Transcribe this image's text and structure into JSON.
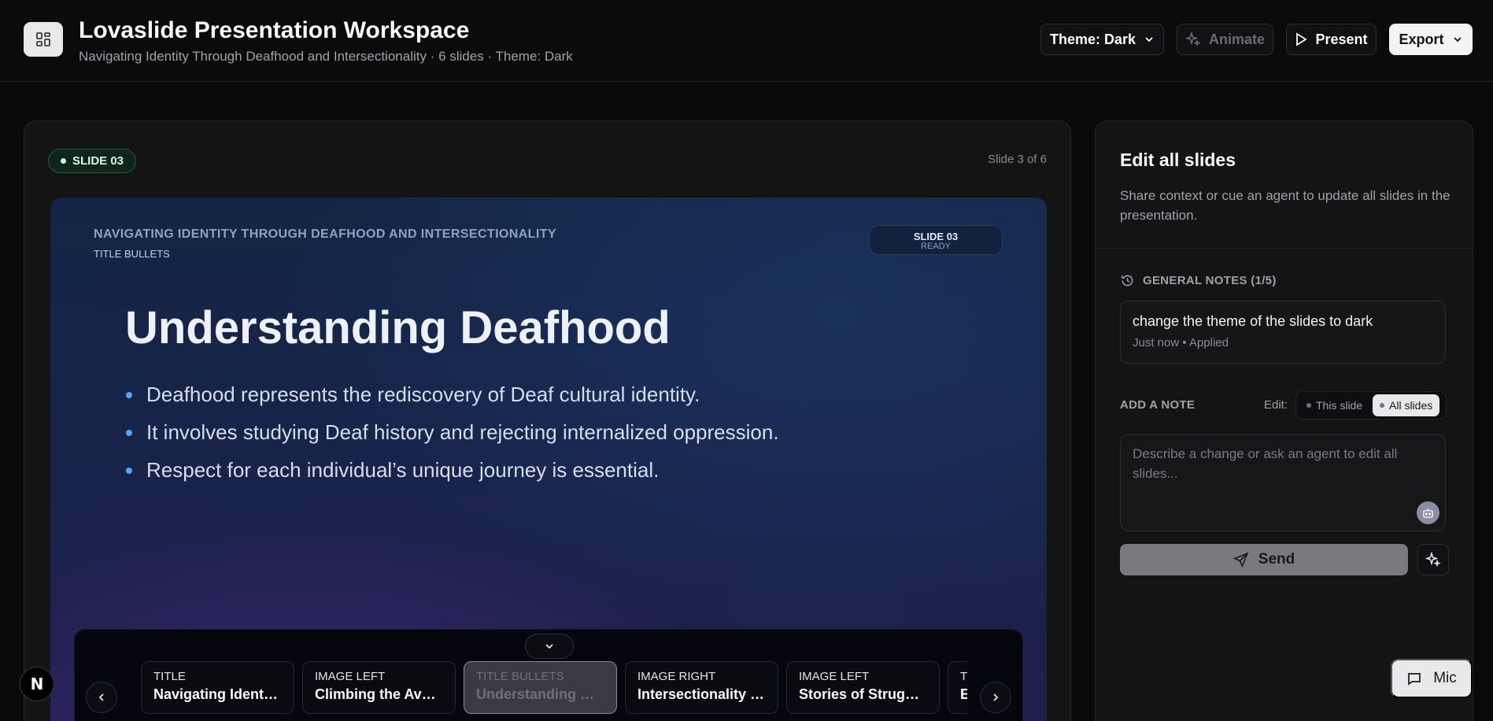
{
  "header": {
    "app_title": "Lovaslide Presentation Workspace",
    "subtitle": "Navigating Identity Through Deafhood and Intersectionality · 6 slides · Theme: Dark",
    "theme_button": "Theme: Dark",
    "animate_button": "Animate",
    "present_button": "Present",
    "export_button": "Export"
  },
  "editor": {
    "slide_badge": "SLIDE 03",
    "slide_count": "Slide 3 of 6",
    "slide": {
      "deck_title": "NAVIGATING IDENTITY THROUGH DEAFHOOD AND INTERSECTIONALITY",
      "layout": "TITLE BULLETS",
      "status_top": "SLIDE 03",
      "status_bottom": "READY",
      "heading": "Understanding Deafhood",
      "bullets": [
        "Deafhood represents the rediscovery of Deaf cultural identity.",
        "It involves studying Deaf history and rejecting internalized oppression.",
        "Respect for each individual’s unique journey is essential."
      ]
    },
    "filmstrip": {
      "thumbs": [
        {
          "type": "TITLE",
          "name": "Navigating Identity T..."
        },
        {
          "type": "IMAGE LEFT",
          "name": "Climbing the Avalanc..."
        },
        {
          "type": "TITLE BULLETS",
          "name": "Understanding Deafh..."
        },
        {
          "type": "IMAGE RIGHT",
          "name": "Intersectionality Expl..."
        },
        {
          "type": "IMAGE LEFT",
          "name": "Stories of Struggle an..."
        },
        {
          "type": "TITLE",
          "name": "En..."
        }
      ]
    }
  },
  "side_panel": {
    "title": "Edit all slides",
    "description": "Share context or cue an agent to update all slides in the presentation.",
    "notes_header": "GENERAL NOTES (1/5)",
    "note": {
      "text": "change the theme of the slides to dark",
      "meta": "Just now • Applied"
    },
    "add_note_label": "ADD A NOTE",
    "edit_label": "Edit:",
    "scope_this": "This slide",
    "scope_all": "All slides",
    "input_placeholder": "Describe a change or ask an agent to edit all slides...",
    "send_button": "Send"
  },
  "mic_button": "Mic",
  "logo_letter": "N",
  "colors": {
    "background": "#0a0a0a",
    "panel": "#141415",
    "accent_badge": "#10261d",
    "bullet": "#4aa8ff"
  }
}
